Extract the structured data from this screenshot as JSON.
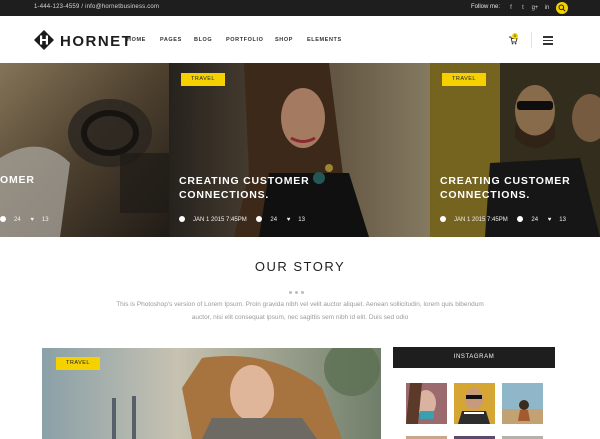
{
  "topbar": {
    "contact": "1-444-123-4559 / info@hornetbusiness.com",
    "follow_label": "Follow me:",
    "social_icons": [
      "facebook-icon",
      "twitter-icon",
      "google-plus-icon",
      "linkedin-icon"
    ],
    "social_glyphs": [
      "f",
      "t",
      "g+",
      "in"
    ]
  },
  "brand": {
    "name": "HORNET",
    "accent": "#f5d100",
    "dark": "#1e1e1e"
  },
  "nav": {
    "items": [
      "HOME",
      "PAGES",
      "BLOG",
      "PORTFOLIO",
      "SHOP",
      "ELEMENTS"
    ]
  },
  "cart": {
    "count": "0"
  },
  "hero": {
    "slides": [
      {
        "title_visible": "OMER",
        "comments": "24",
        "likes": "13"
      },
      {
        "tag": "TRAVEL",
        "title_line1": "CREATING CUSTOMER",
        "title_line2": "CONNECTIONS.",
        "date": "JAN 1 2015  7:45PM",
        "comments": "24",
        "likes": "13"
      },
      {
        "tag": "TRAVEL",
        "title_line1": "CREATING CUSTOMER",
        "title_line2": "CONNECTIONS.",
        "date": "JAN 1 2015  7:45PM",
        "comments": "24",
        "likes": "13"
      }
    ]
  },
  "story": {
    "title": "OUR STORY",
    "text_line1": "This is Photoshop's version  of Lorem Ipsum. Proin gravida nibh vel velit auctor aliquet. Aenean sollicitudin, lorem quis bibendum",
    "text_line2": "auctor, nisi elit consequat ipsum, nec sagittis sem nibh id elit. Duis sed odio"
  },
  "feature": {
    "tag": "TRAVEL"
  },
  "instagram": {
    "heading": "INSTAGRAM"
  }
}
